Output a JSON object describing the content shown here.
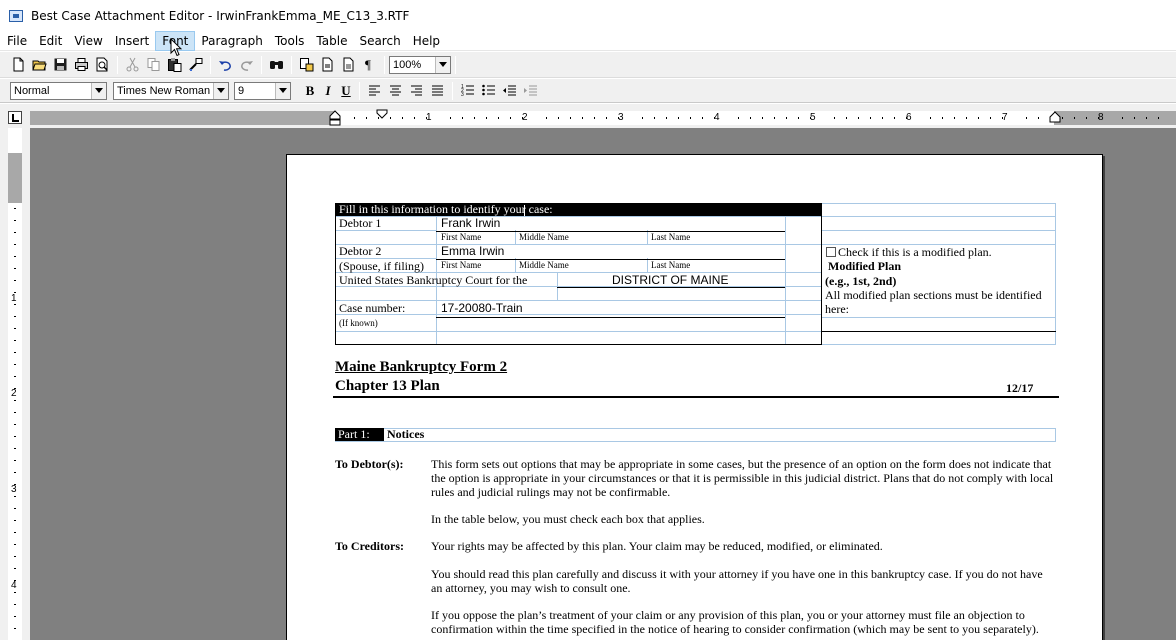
{
  "window": {
    "title": "Best Case Attachment Editor - IrwinFrankEmma_ME_C13_3.RTF"
  },
  "menu": [
    "File",
    "Edit",
    "View",
    "Insert",
    "Font",
    "Paragraph",
    "Tools",
    "Table",
    "Search",
    "Help"
  ],
  "toolbar": {
    "zoom": "100%"
  },
  "format_bar": {
    "style": "Normal",
    "font": "Times New Roman",
    "size": "9",
    "bold": "B",
    "italic": "I",
    "underline": "U"
  },
  "ruler": {
    "numbers": [
      "1",
      "2",
      "3",
      "4",
      "5",
      "6",
      "7",
      "8"
    ],
    "vnumbers": [
      "1",
      "2",
      "3",
      "4"
    ]
  },
  "doc": {
    "header": "Fill in this information to identify your case:",
    "debtor1_label": "Debtor 1",
    "debtor1_name": "Frank Irwin",
    "first_name": "First Name",
    "middle_name": "Middle Name",
    "last_name": "Last Name",
    "debtor2_label": "Debtor 2",
    "debtor2_name": "Emma Irwin",
    "spouse_label": "(Spouse, if filing)",
    "court_label": "United States Bankruptcy Court for the",
    "district": "DISTRICT OF MAINE",
    "case_label": "Case number:",
    "case_number": "17-20080-Train",
    "if_known": "(If known)",
    "check_modified": "Check if this is a modified plan.",
    "modified_plan": "Modified Plan",
    "eg": "(e.g., 1st, 2nd)",
    "all_modified_1": "All modified plan sections must be identified",
    "all_modified_2": "here:",
    "form_title": "Maine Bankruptcy Form 2",
    "chapter_title": "Chapter 13 Plan",
    "form_date": "12/17",
    "part_label": "Part 1:",
    "part_title": "Notices",
    "to_debtors_label": "To Debtor(s):",
    "to_debtors_text": "This form sets out options that may be appropriate in some cases, but the presence of an option on the form does not indicate that the option is appropriate in your circumstances or that it is permissible in this judicial district. Plans that do not comply with local rules and judicial rulings may not be confirmable.",
    "table_below_text": "In the table below, you must check each box that applies.",
    "to_creditors_label": "To Creditors:",
    "creditors_text_1": "Your rights may be affected by this plan. Your claim may be reduced, modified, or eliminated.",
    "creditors_text_2": "You should read this plan carefully and discuss it with your attorney if you have one in this bankruptcy case. If you do not have an attorney, you may wish to consult one.",
    "creditors_text_3": "If you oppose the plan’s treatment of your claim or any provision of this plan, you or your attorney must file an objection to confirmation within the time specified in the notice of hearing to consider confirmation (which may be sent to you separately)."
  }
}
